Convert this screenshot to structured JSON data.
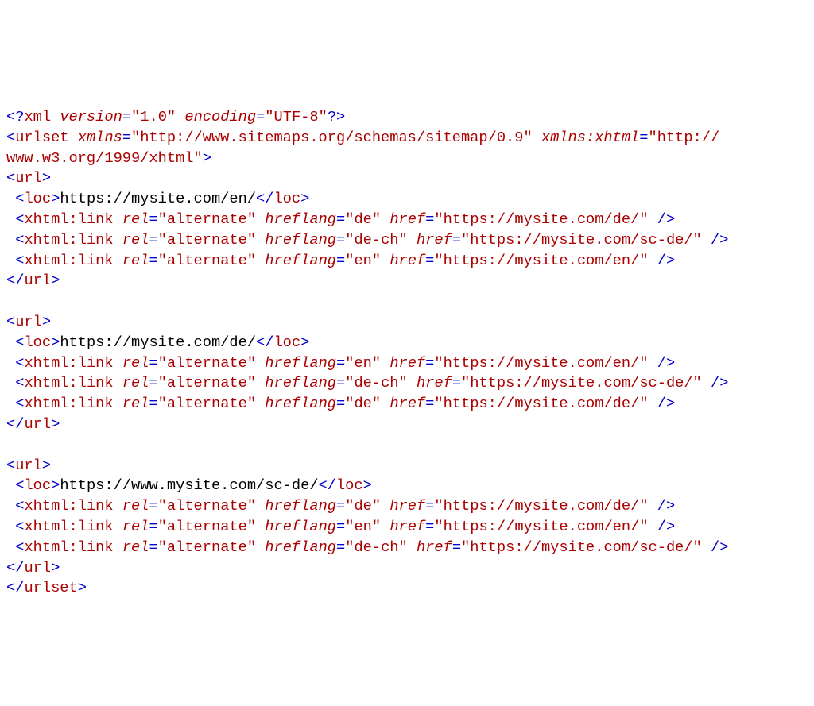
{
  "xml_decl": {
    "version": "1.0",
    "encoding": "UTF-8"
  },
  "urlset": {
    "xmlns": "http://www.sitemaps.org/schemas/sitemap/0.9",
    "xmlns_xhtml": "http://www.w3.org/1999/xhtml",
    "xmlns_xhtml_line1": "http://",
    "xmlns_xhtml_line2": "www.w3.org/1999/xhtml"
  },
  "urls": [
    {
      "loc": "https://mysite.com/en/",
      "links": [
        {
          "rel": "alternate",
          "hreflang": "de",
          "href": "https://mysite.com/de/"
        },
        {
          "rel": "alternate",
          "hreflang": "de-ch",
          "href": "https://mysite.com/sc-de/"
        },
        {
          "rel": "alternate",
          "hreflang": "en",
          "href": "https://mysite.com/en/"
        }
      ]
    },
    {
      "loc": "https://mysite.com/de/",
      "links": [
        {
          "rel": "alternate",
          "hreflang": "en",
          "href": "https://mysite.com/en/"
        },
        {
          "rel": "alternate",
          "hreflang": "de-ch",
          "href": "https://mysite.com/sc-de/"
        },
        {
          "rel": "alternate",
          "hreflang": "de",
          "href": "https://mysite.com/de/"
        }
      ]
    },
    {
      "loc": "https://www.mysite.com/sc-de/",
      "links": [
        {
          "rel": "alternate",
          "hreflang": "de",
          "href": "https://mysite.com/de/"
        },
        {
          "rel": "alternate",
          "hreflang": "en",
          "href": "https://mysite.com/en/"
        },
        {
          "rel": "alternate",
          "hreflang": "de-ch",
          "href": "https://mysite.com/sc-de/"
        }
      ]
    }
  ]
}
